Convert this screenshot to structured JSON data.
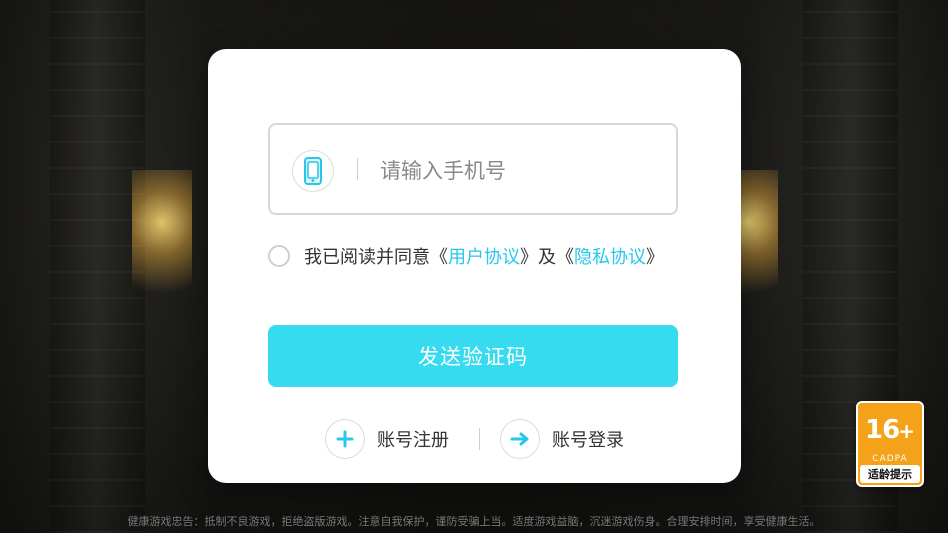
{
  "phone_field": {
    "placeholder": "请输入手机号",
    "icon": "phone-icon"
  },
  "agreement": {
    "prefix": "我已阅读并同意",
    "open_bracket_1": "《",
    "user_agreement": "用户协议",
    "close_bracket_1": "》",
    "and": "及",
    "open_bracket_2": "《",
    "privacy_agreement": "隐私协议",
    "close_bracket_2": "》"
  },
  "send_button": {
    "label": "发送验证码"
  },
  "actions": {
    "register": {
      "label": "账号注册",
      "icon": "plus-icon"
    },
    "login": {
      "label": "账号登录",
      "icon": "arrow-right-icon"
    }
  },
  "age_badge": {
    "age": "16",
    "plus": "+",
    "org": "CADPA",
    "tip": "适龄提示"
  },
  "footer": {
    "text": "健康游戏忠告：抵制不良游戏，拒绝盗版游戏。注意自我保护，谨防受骗上当。适度游戏益脑，沉迷游戏伤身。合理安排时间，享受健康生活。"
  },
  "colors": {
    "accent": "#27c6ea",
    "button": "#36dbf0",
    "badge": "#f3a21a"
  }
}
